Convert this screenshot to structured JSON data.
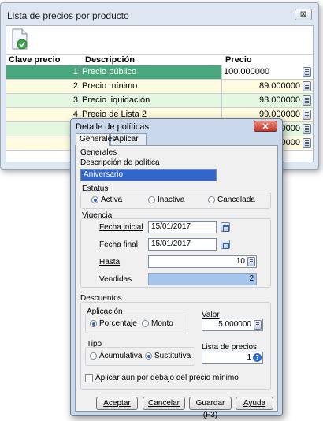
{
  "window": {
    "title": "Lista de precios por producto",
    "close_symbol": "⊠"
  },
  "grid": {
    "columns": [
      "Clave precio",
      "Descripción",
      "Precio"
    ],
    "rows": [
      {
        "clave": "1",
        "descripcion": "Precio público",
        "precio": "100.000000"
      },
      {
        "clave": "2",
        "descripcion": "Precio mínimo",
        "precio": "89.000000"
      },
      {
        "clave": "3",
        "descripcion": "Precio liquidación",
        "precio": "93.000000"
      },
      {
        "clave": "4",
        "descripcion": "Precio de Lista 2",
        "precio": "99.000000"
      },
      {
        "clave": "",
        "descripcion": "",
        "precio": "00000"
      },
      {
        "clave": "",
        "descripcion": "",
        "precio": "00000"
      }
    ]
  },
  "dialog": {
    "title": "Detalle de políticas",
    "close_symbol": "✕",
    "tabs": [
      "Generales",
      "Aplicar a..."
    ],
    "generales": {
      "section_label": "Generales",
      "desc_label": "Descripción de política",
      "desc_value": "Aniversario"
    },
    "estatus": {
      "label": "Estatus",
      "options": [
        "Activa",
        "Inactiva",
        "Cancelada"
      ],
      "selected": 0
    },
    "vigencia": {
      "label": "Vigencia",
      "fecha_inicial_label": "Fecha inicial",
      "fecha_inicial_value": "15/01/2017",
      "fecha_final_label": "Fecha final",
      "fecha_final_value": "15/01/2017",
      "hasta_label": "Hasta",
      "hasta_value": "10",
      "vendidas_label": "Vendidas",
      "vendidas_value": "2"
    },
    "descuentos": {
      "label": "Descuentos",
      "aplicacion_label": "Aplicación",
      "aplicacion_options": [
        "Porcentaje",
        "Monto"
      ],
      "aplicacion_selected": 0,
      "valor_label": "Valor",
      "valor_value": "5.000000",
      "tipo_label": "Tipo",
      "tipo_options": [
        "Acumulativa",
        "Sustitutiva"
      ],
      "tipo_selected": 1,
      "lista_label": "Lista de precios",
      "lista_value": "1",
      "check_label": "Aplicar aun por debajo del precio mínimo",
      "check_checked": false
    },
    "buttons": {
      "aceptar": "Aceptar",
      "cancelar": "Cancelar",
      "guardar": "Guardar (F3)",
      "ayuda": "Ayuda"
    }
  },
  "colors": {
    "selected_row": "#4aa87e",
    "row_yellow": "#fefbe0",
    "row_green": "#e4f7e0",
    "dialog_frame": "#c9d8eb",
    "close_red": "#c0372a"
  }
}
